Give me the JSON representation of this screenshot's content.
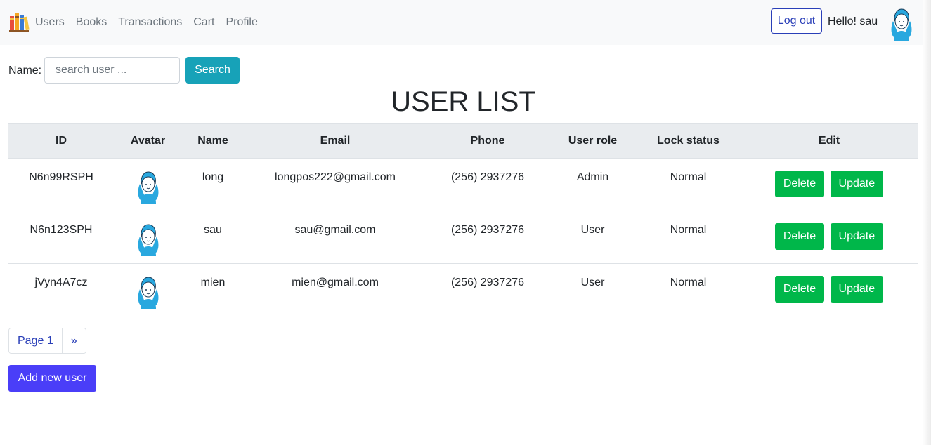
{
  "nav": {
    "links": [
      "Users",
      "Books",
      "Transactions",
      "Cart",
      "Profile"
    ],
    "logout_label": "Log out",
    "greeting": "Hello! sau"
  },
  "search": {
    "label": "Name:",
    "placeholder": "search user ...",
    "button_label": "Search"
  },
  "page_title": "USER LIST",
  "table": {
    "headers": [
      "ID",
      "Avatar",
      "Name",
      "Email",
      "Phone",
      "User role",
      "Lock status",
      "Edit"
    ],
    "rows": [
      {
        "id": "N6n99RSPH",
        "name": "long",
        "email": "longpos222@gmail.com",
        "phone": "(256) 2937276",
        "role": "Admin",
        "lock": "Normal"
      },
      {
        "id": "N6n123SPH",
        "name": "sau",
        "email": "sau@gmail.com",
        "phone": "(256) 2937276",
        "role": "User",
        "lock": "Normal"
      },
      {
        "id": "jVyn4A7cz",
        "name": "mien",
        "email": "mien@gmail.com",
        "phone": "(256) 2937276",
        "role": "User",
        "lock": "Normal"
      }
    ],
    "delete_label": "Delete",
    "update_label": "Update"
  },
  "pagination": {
    "page_label": "Page 1",
    "next_label": "»"
  },
  "add_button_label": "Add new user",
  "colors": {
    "navbar_bg": "#f8f9fa",
    "search_btn": "#17a2b8",
    "action_green": "#00b74a",
    "add_btn": "#4a3ef8",
    "link_blue": "#2a3fb8",
    "header_bg": "#e9ecef"
  },
  "icons": {
    "brand": "books-logo-icon",
    "avatar": "woman-avatar-icon"
  }
}
